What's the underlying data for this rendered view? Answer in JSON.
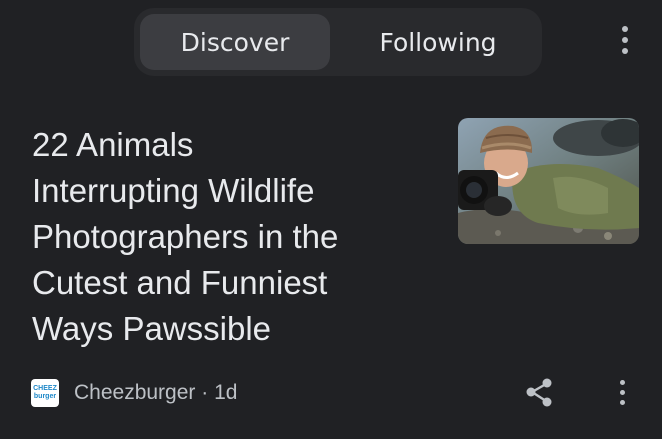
{
  "tabs": [
    {
      "label": "Discover",
      "active": true
    },
    {
      "label": "Following",
      "active": false
    }
  ],
  "menu_icon": "more-vert-icon",
  "article": {
    "headline_lines": [
      "22 Animals",
      "Interrupting Wildlife",
      "Photographers in the",
      "Cutest and Funniest",
      "Ways Pawssible"
    ],
    "thumbnail_description_icon": "photo-thumbnail",
    "source_logo_text": [
      "CHEEZ",
      "burger"
    ],
    "source_name": "Cheezburger",
    "separator": "·",
    "age": "1d",
    "share_icon": "share-icon",
    "more_icon": "more-vert-icon"
  },
  "colors": {
    "background": "#202124",
    "tabbar": "#292a2d",
    "active_tab": "#3c3d41",
    "text_primary": "#e8eaed",
    "text_secondary": "#bdc1c6",
    "logo_blue": "#1e88c9"
  }
}
